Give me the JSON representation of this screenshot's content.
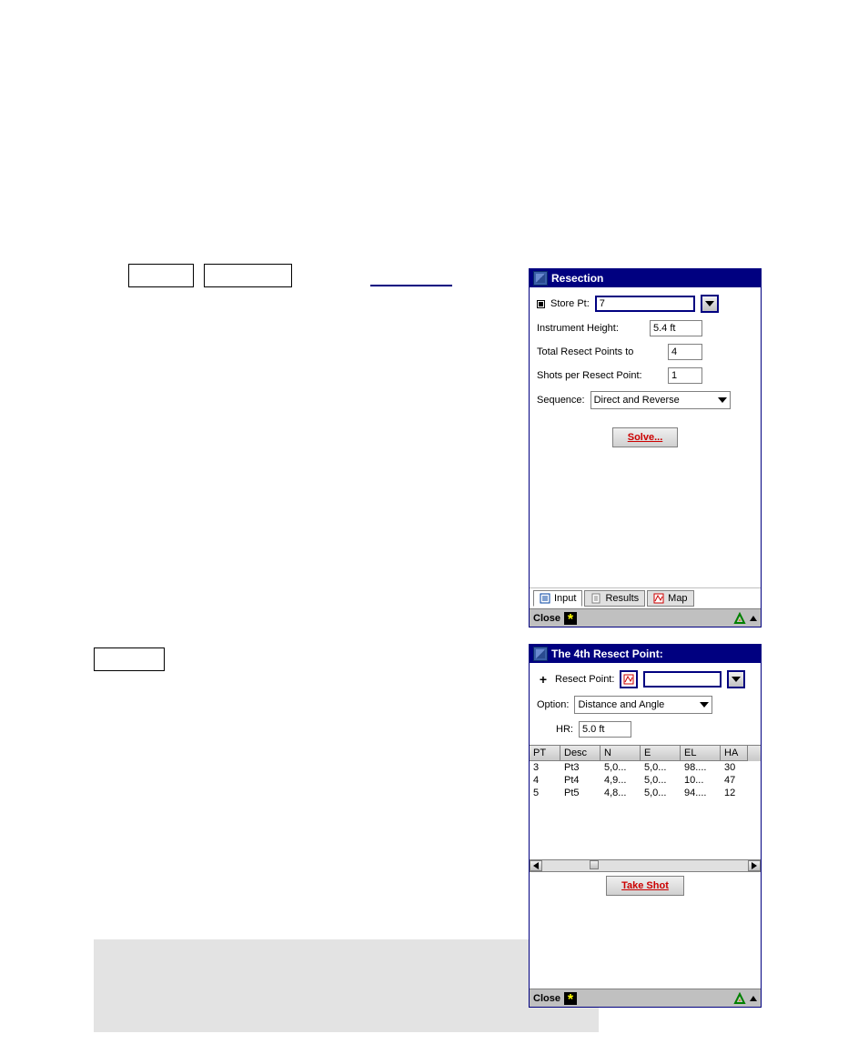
{
  "colors": {
    "titlebar": "#000080",
    "danger": "#cc0000",
    "panel": "#c0c0c0"
  },
  "dialog_resection": {
    "title": "Resection",
    "store_pt_label": "Store Pt:",
    "store_pt_value": "7",
    "instrument_height_label": "Instrument Height:",
    "instrument_height_value": "5.4 ft",
    "total_points_label": "Total Resect Points to",
    "total_points_value": "4",
    "shots_per_label": "Shots per Resect Point:",
    "shots_per_value": "1",
    "sequence_label": "Sequence:",
    "sequence_value": "Direct and Reverse",
    "solve_button": "Solve...",
    "tabs": {
      "input": "Input",
      "results": "Results",
      "map": "Map"
    },
    "close": "Close"
  },
  "dialog_nth_point": {
    "title": "The 4th Resect Point:",
    "resect_point_label": "Resect Point:",
    "resect_point_value": "",
    "option_label": "Option:",
    "option_value": "Distance and Angle",
    "hr_label": "HR:",
    "hr_value": "5.0 ft",
    "columns": {
      "pt": "PT",
      "desc": "Desc",
      "n": "N",
      "e": "E",
      "el": "EL",
      "ha": "HA"
    },
    "rows": [
      {
        "pt": "3",
        "desc": "Pt3",
        "n": "5,0...",
        "e": "5,0...",
        "el": "98....",
        "ha": "30"
      },
      {
        "pt": "4",
        "desc": "Pt4",
        "n": "4,9...",
        "e": "5,0...",
        "el": "10...",
        "ha": "47"
      },
      {
        "pt": "5",
        "desc": "Pt5",
        "n": "4,8...",
        "e": "5,0...",
        "el": "94....",
        "ha": "12"
      }
    ],
    "take_shot_button": "Take Shot",
    "close": "Close"
  }
}
